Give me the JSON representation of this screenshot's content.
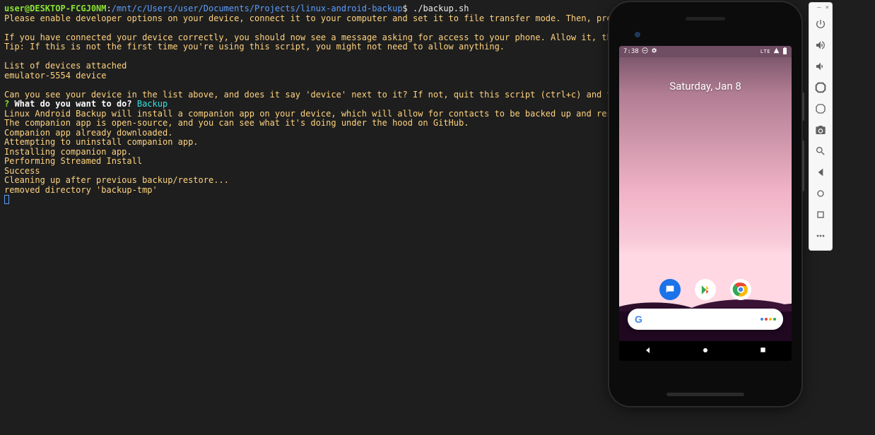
{
  "terminal": {
    "prompt_user": "user@DESKTOP-FCGJ0NM",
    "prompt_sep": ":",
    "prompt_path": "/mnt/c/Users/user/Documents/Projects/linux-android-backup",
    "prompt_end": "$ ",
    "command": "./backup.sh",
    "line_intro": "Please enable developer options on your device, connect it to your computer and set it to file transfer mode. Then, press Enter to continue.",
    "line_connected": "If you have connected your device correctly, you should now see a message asking for access to your phone. Allow it, then press Enter to go to",
    "line_tip": "Tip: If this is not the first time you're using this script, you might not need to allow anything.",
    "line_listhdr": "List of devices attached",
    "line_device": "emulator-5554   device",
    "line_seeq": "Can you see your device in the list above, and does it say 'device' next to it? If not, quit this script (ctrl+c) and try again.",
    "q_mark": "?",
    "q_text": " What do you want to do? ",
    "q_answer": "Backup",
    "line_install": "Linux Android Backup will install a companion app on your device, which will allow for contacts to be backed up and restored.",
    "line_oss": "The companion app is open-source, and you can see what it's doing under the hood on GitHub.",
    "line_dl": "Companion app already downloaded.",
    "line_uninst": "Attempting to uninstall companion app.",
    "line_inst": "Installing companion app.",
    "line_stream": "Performing Streamed Install",
    "line_success": "Success",
    "line_clean": "Cleaning up after previous backup/restore...",
    "line_removed": "removed directory 'backup-tmp'"
  },
  "emulator": {
    "status_time": "7:38",
    "status_net": "LTE",
    "date_text": "Saturday, Jan 8"
  },
  "colors": {
    "messages": "#1a73e8",
    "chrome_red": "#ea4335",
    "chrome_yellow": "#fbbc05",
    "chrome_green": "#34a853",
    "chrome_blue": "#4285f4"
  }
}
